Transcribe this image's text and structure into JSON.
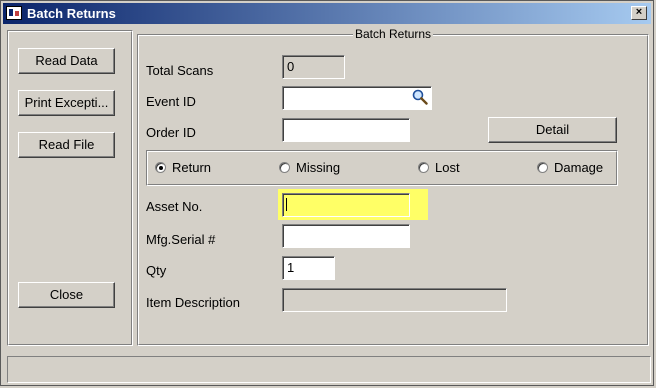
{
  "window": {
    "title": "Batch Returns",
    "close_label": "×"
  },
  "sidebar": {
    "read_data_label": "Read Data",
    "print_exceptions_label": "Print Excepti...",
    "read_file_label": "Read File",
    "close_label": "Close"
  },
  "main": {
    "group_title": "Batch Returns",
    "total_scans": {
      "label": "Total Scans",
      "value": "0"
    },
    "event_id": {
      "label": "Event ID",
      "value": ""
    },
    "order_id": {
      "label": "Order ID",
      "value": ""
    },
    "detail_label": "Detail",
    "radio_options": [
      {
        "label": "Return",
        "checked": true
      },
      {
        "label": "Missing",
        "checked": false
      },
      {
        "label": "Lost",
        "checked": false
      },
      {
        "label": "Damage",
        "checked": false
      }
    ],
    "asset_no": {
      "label": "Asset No.",
      "value": ""
    },
    "mfg_serial": {
      "label": "Mfg.Serial #",
      "value": ""
    },
    "qty": {
      "label": "Qty",
      "value": "1"
    },
    "item_description": {
      "label": "Item Description",
      "value": ""
    }
  },
  "status": {
    "text": ""
  },
  "colors": {
    "title_start": "#0a246a",
    "title_end": "#a6caf0",
    "highlight": "#ffff66",
    "face": "#d4d0c8"
  }
}
